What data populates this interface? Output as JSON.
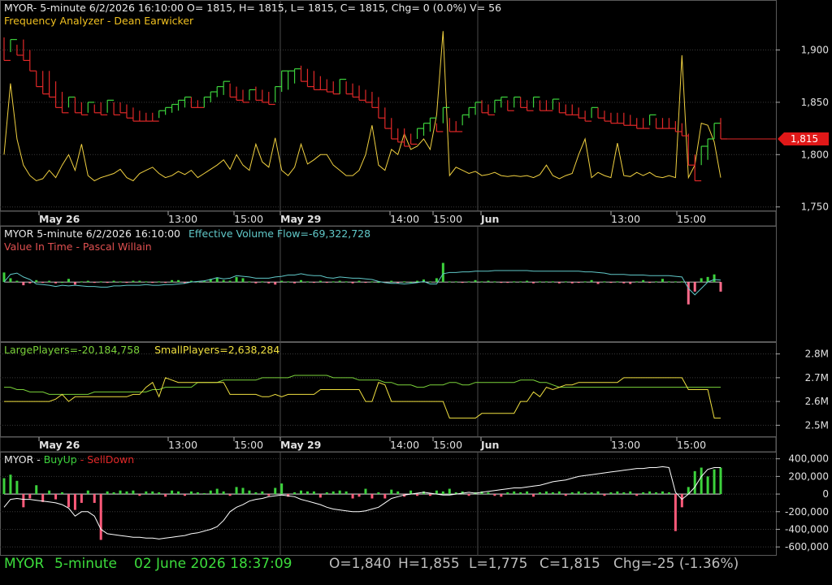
{
  "colors": {
    "background": "#000000",
    "grid": "#3a3a3a",
    "axis_text": "#e0e0e0",
    "up": "#3cd23c",
    "down": "#e02828",
    "yellow": "#f0d040",
    "cyan": "#60c8c8",
    "white": "#ffffff",
    "green_line": "#7ad23a",
    "price_tag": "#e01818",
    "status_green": "#3cdc3c",
    "status_gray": "#bdbdbd"
  },
  "panels": {
    "price": {
      "header_line1": "MYOR- 5-minute 6/2/2026 16:10:00 O= 1815, H= 1815, L= 1815, C= 1815, Chg= 0 (0.0%) V= 56",
      "header_line2": "Frequency Analyzer - Dean Earwicker",
      "last_price_label": "1,815"
    },
    "evf": {
      "header_prefix": "MYOR 5-minute  6/2/2026 16:10:00",
      "header_value": "Effective Volume Flow=-69,322,728",
      "header_line2": "Value In Time - Pascal Willain"
    },
    "players": {
      "large_label": "LargePlayers=-20,184,758",
      "small_label": "SmallPlayers=2,638,284"
    },
    "buysell": {
      "label_symbol": "MYOR - ",
      "label_buy": "BuyUp",
      "label_dash": "-",
      "label_sell": "SellDown"
    }
  },
  "time_axis_labels": [
    "May 26",
    "13:00",
    "15:00",
    "May 29",
    "14:00",
    "15:00",
    "Jun",
    "13:00",
    "15:00"
  ],
  "status_bar": {
    "symbol": "MYOR",
    "interval": "5-minute",
    "datetime": "02 June 2026 18:37:09",
    "open": "O=1,840",
    "high": "H=1,855",
    "low": "L=1,775",
    "close": "C=1,815",
    "change": "Chg=-25 (-1.36%)"
  },
  "chart_data": [
    {
      "type": "line",
      "name": "price",
      "y_ticks": [
        "1,900",
        "1,850",
        "1,800",
        "1,750"
      ],
      "ylim": [
        1742,
        1940
      ],
      "x_points": 112,
      "bar_high": [
        1912,
        1910,
        1905,
        1910,
        1900,
        1880,
        1880,
        1880,
        1870,
        1860,
        1855,
        1855,
        1850,
        1850,
        1848,
        1850,
        1852,
        1850,
        1850,
        1848,
        1845,
        1842,
        1840,
        1840,
        1842,
        1845,
        1848,
        1852,
        1855,
        1855,
        1852,
        1855,
        1860,
        1865,
        1870,
        1868,
        1865,
        1862,
        1862,
        1865,
        1862,
        1860,
        1865,
        1880,
        1880,
        1882,
        1885,
        1882,
        1880,
        1875,
        1872,
        1870,
        1872,
        1870,
        1868,
        1866,
        1862,
        1860,
        1855,
        1845,
        1835,
        1825,
        1825,
        1820,
        1825,
        1830,
        1835,
        1830,
        1845,
        1835,
        1832,
        1838,
        1845,
        1850,
        1852,
        1848,
        1852,
        1855,
        1852,
        1855,
        1855,
        1852,
        1855,
        1852,
        1852,
        1853,
        1850,
        1848,
        1848,
        1845,
        1842,
        1845,
        1845,
        1842,
        1840,
        1840,
        1840,
        1838,
        1835,
        1835,
        1838,
        1835,
        1835,
        1835,
        1832,
        1830,
        1820,
        1800,
        1808,
        1815,
        1830,
        1835
      ],
      "bar_low": [
        1890,
        1898,
        1895,
        1890,
        1880,
        1865,
        1858,
        1855,
        1845,
        1840,
        1845,
        1840,
        1838,
        1840,
        1840,
        1838,
        1840,
        1838,
        1840,
        1835,
        1832,
        1832,
        1832,
        1832,
        1835,
        1838,
        1840,
        1842,
        1845,
        1845,
        1845,
        1845,
        1850,
        1855,
        1857,
        1855,
        1852,
        1850,
        1852,
        1852,
        1850,
        1848,
        1850,
        1860,
        1862,
        1868,
        1870,
        1865,
        1862,
        1862,
        1860,
        1858,
        1858,
        1858,
        1855,
        1852,
        1850,
        1845,
        1835,
        1825,
        1815,
        1812,
        1808,
        1810,
        1815,
        1818,
        1822,
        1822,
        1830,
        1822,
        1822,
        1828,
        1835,
        1838,
        1840,
        1838,
        1840,
        1845,
        1842,
        1845,
        1845,
        1842,
        1845,
        1842,
        1842,
        1843,
        1840,
        1838,
        1838,
        1835,
        1832,
        1835,
        1835,
        1832,
        1830,
        1830,
        1828,
        1828,
        1825,
        1825,
        1828,
        1825,
        1825,
        1825,
        1822,
        1818,
        1790,
        1775,
        1790,
        1795,
        1815,
        1815
      ],
      "bar_up": [
        false,
        true,
        false,
        false,
        false,
        false,
        false,
        false,
        false,
        false,
        true,
        false,
        false,
        true,
        false,
        false,
        true,
        false,
        false,
        false,
        false,
        false,
        false,
        false,
        true,
        true,
        true,
        true,
        true,
        false,
        false,
        true,
        true,
        true,
        true,
        false,
        false,
        false,
        true,
        false,
        false,
        false,
        true,
        true,
        true,
        true,
        false,
        false,
        false,
        false,
        false,
        false,
        true,
        false,
        false,
        false,
        false,
        false,
        false,
        false,
        false,
        false,
        false,
        false,
        true,
        true,
        true,
        false,
        true,
        false,
        false,
        true,
        true,
        true,
        false,
        false,
        true,
        true,
        false,
        true,
        false,
        false,
        true,
        false,
        false,
        true,
        false,
        false,
        false,
        false,
        false,
        true,
        false,
        false,
        false,
        false,
        false,
        false,
        false,
        false,
        true,
        false,
        false,
        false,
        false,
        false,
        false,
        false,
        true,
        true,
        true,
        false
      ],
      "frequency": [
        1800,
        1868,
        1815,
        1790,
        1780,
        1775,
        1777,
        1785,
        1778,
        1790,
        1800,
        1785,
        1810,
        1780,
        1775,
        1778,
        1780,
        1782,
        1786,
        1778,
        1775,
        1782,
        1785,
        1788,
        1782,
        1778,
        1780,
        1784,
        1781,
        1785,
        1778,
        1782,
        1786,
        1790,
        1795,
        1786,
        1800,
        1790,
        1785,
        1810,
        1793,
        1788,
        1816,
        1785,
        1780,
        1788,
        1810,
        1791,
        1795,
        1800,
        1800,
        1790,
        1785,
        1780,
        1780,
        1785,
        1800,
        1828,
        1790,
        1785,
        1805,
        1800,
        1820,
        1805,
        1808,
        1815,
        1805,
        1838,
        1918,
        1780,
        1788,
        1785,
        1782,
        1784,
        1780,
        1781,
        1783,
        1780,
        1779,
        1780,
        1779,
        1780,
        1778,
        1781,
        1790,
        1780,
        1777,
        1780,
        1782,
        1800,
        1815,
        1778,
        1783,
        1780,
        1778,
        1811,
        1780,
        1779,
        1783,
        1780,
        1783,
        1779,
        1778,
        1780,
        1778,
        1895,
        1778,
        1790,
        1830,
        1828,
        1812,
        1778
      ]
    },
    {
      "type": "line",
      "name": "effective-volume-flow",
      "line": [
        0,
        0.12,
        0.14,
        0.08,
        0.04,
        -0.03,
        -0.04,
        -0.05,
        -0.07,
        -0.05,
        -0.06,
        -0.05,
        -0.06,
        -0.07,
        -0.07,
        -0.08,
        -0.08,
        -0.06,
        -0.06,
        -0.05,
        -0.05,
        -0.05,
        -0.04,
        -0.05,
        -0.05,
        -0.04,
        -0.04,
        -0.03,
        -0.02,
        0,
        0.01,
        0.02,
        0.04,
        0.07,
        0.05,
        0.06,
        0.1,
        0.09,
        0.08,
        0.06,
        0.06,
        0.06,
        0.08,
        0.09,
        0.11,
        0.11,
        0.13,
        0.11,
        0.1,
        0.1,
        0.07,
        0.06,
        0.08,
        0.07,
        0.06,
        0.06,
        0.05,
        0.04,
        0.01,
        -0.01,
        -0.02,
        -0.02,
        -0.03,
        -0.02,
        -0.01,
        0.01,
        -0.03,
        -0.03,
        0.13,
        0.15,
        0.15,
        0.16,
        0.16,
        0.17,
        0.17,
        0.17,
        0.18,
        0.18,
        0.18,
        0.18,
        0.18,
        0.18,
        0.17,
        0.17,
        0.17,
        0.17,
        0.17,
        0.17,
        0.17,
        0.17,
        0.16,
        0.16,
        0.15,
        0.14,
        0.12,
        0.12,
        0.12,
        0.11,
        0.11,
        0.11,
        0.1,
        0.1,
        0.1,
        0.1,
        0.09,
        0.08,
        -0.1,
        -0.2,
        -0.1,
        0,
        0.04,
        0.03
      ],
      "bars": [
        0.15,
        0.06,
        0.02,
        -0.05,
        -0.02,
        0.03,
        -0.01,
        0.02,
        -0.02,
        0,
        0.05,
        -0.04,
        0.01,
        0.02,
        -0.01,
        0.01,
        -0.01,
        0.02,
        0.01,
        -0.01,
        0.02,
        0.02,
        0.01,
        -0.01,
        0.01,
        -0.01,
        0.03,
        0.03,
        -0.02,
        0.02,
        0.01,
        0.02,
        0.05,
        0.07,
        0.03,
        0.02,
        0.08,
        0.06,
        0.01,
        -0.02,
        0.01,
        -0.02,
        -0.04,
        0.02,
        0.01,
        -0.02,
        0.03,
        0.01,
        -0.01,
        0.02,
        -0.01,
        0.01,
        0.02,
        0.01,
        -0.02,
        0.02,
        -0.01,
        0.01,
        0,
        -0.01,
        0.02,
        -0.02,
        0.01,
        0,
        0.02,
        0.04,
        0.01,
        0.06,
        0.3,
        0.01,
        0.01,
        -0.01,
        0.01,
        0.03,
        0.01,
        0.02,
        0.01,
        -0.01,
        -0.01,
        0.01,
        0.01,
        0.02,
        -0.02,
        0.01,
        0.01,
        0.01,
        -0.02,
        0.01,
        -0.02,
        -0.01,
        0.01,
        0.03,
        -0.03,
        0.01,
        -0.01,
        0.01,
        -0.02,
        -0.03,
        0.01,
        0.03,
        -0.01,
        0.01,
        0.05,
        0.01,
        0.01,
        0.01,
        -0.35,
        -0.15,
        0.06,
        0.08,
        0.12,
        -0.15
      ],
      "ylim": [
        -0.8,
        0.6
      ]
    },
    {
      "type": "line",
      "name": "large-small-players",
      "y_ticks": [
        "2.8M",
        "2.7M",
        "2.6M",
        "2.5M"
      ],
      "ylim": [
        2.45,
        2.85
      ],
      "large": [
        2.66,
        2.66,
        2.65,
        2.65,
        2.64,
        2.64,
        2.64,
        2.63,
        2.63,
        2.63,
        2.63,
        2.63,
        2.63,
        2.63,
        2.64,
        2.64,
        2.64,
        2.64,
        2.64,
        2.64,
        2.64,
        2.64,
        2.64,
        2.65,
        2.65,
        2.66,
        2.66,
        2.66,
        2.66,
        2.66,
        2.68,
        2.68,
        2.68,
        2.68,
        2.69,
        2.69,
        2.69,
        2.69,
        2.69,
        2.69,
        2.7,
        2.7,
        2.7,
        2.7,
        2.7,
        2.71,
        2.71,
        2.71,
        2.71,
        2.71,
        2.71,
        2.7,
        2.7,
        2.7,
        2.7,
        2.69,
        2.69,
        2.69,
        2.69,
        2.68,
        2.68,
        2.67,
        2.67,
        2.67,
        2.66,
        2.66,
        2.67,
        2.67,
        2.67,
        2.68,
        2.68,
        2.67,
        2.67,
        2.68,
        2.68,
        2.68,
        2.68,
        2.68,
        2.68,
        2.68,
        2.69,
        2.69,
        2.69,
        2.68,
        2.68,
        2.67,
        2.66,
        2.66,
        2.66,
        2.66,
        2.66,
        2.66,
        2.66,
        2.66,
        2.66,
        2.66,
        2.66,
        2.66,
        2.66,
        2.66,
        2.66,
        2.66,
        2.66,
        2.66,
        2.66,
        2.66,
        2.66,
        2.66,
        2.66,
        2.66,
        2.66,
        2.66
      ],
      "small": [
        2.6,
        2.6,
        2.6,
        2.6,
        2.6,
        2.6,
        2.6,
        2.6,
        2.61,
        2.63,
        2.6,
        2.62,
        2.62,
        2.62,
        2.62,
        2.62,
        2.62,
        2.62,
        2.62,
        2.62,
        2.63,
        2.63,
        2.66,
        2.68,
        2.62,
        2.7,
        2.69,
        2.68,
        2.68,
        2.68,
        2.68,
        2.68,
        2.68,
        2.68,
        2.68,
        2.63,
        2.63,
        2.63,
        2.63,
        2.63,
        2.62,
        2.62,
        2.63,
        2.62,
        2.63,
        2.63,
        2.63,
        2.63,
        2.63,
        2.65,
        2.65,
        2.65,
        2.65,
        2.65,
        2.65,
        2.65,
        2.6,
        2.6,
        2.68,
        2.67,
        2.6,
        2.6,
        2.6,
        2.6,
        2.6,
        2.6,
        2.6,
        2.6,
        2.6,
        2.53,
        2.53,
        2.53,
        2.53,
        2.53,
        2.55,
        2.55,
        2.55,
        2.55,
        2.55,
        2.55,
        2.6,
        2.6,
        2.64,
        2.62,
        2.66,
        2.65,
        2.66,
        2.67,
        2.67,
        2.68,
        2.68,
        2.68,
        2.68,
        2.68,
        2.68,
        2.68,
        2.7,
        2.7,
        2.7,
        2.7,
        2.7,
        2.7,
        2.7,
        2.7,
        2.7,
        2.7,
        2.65,
        2.65,
        2.65,
        2.65,
        2.53,
        2.53
      ]
    },
    {
      "type": "bar",
      "name": "buyup-selldown",
      "y_ticks": [
        "400,000",
        "200,000",
        "0",
        "-200,000",
        "-400,000",
        "-600,000"
      ],
      "ylim": [
        -700000,
        480000
      ],
      "bars": [
        180000,
        220000,
        150000,
        -150000,
        -50000,
        100000,
        -90000,
        40000,
        -60000,
        20000,
        -150000,
        -180000,
        -100000,
        40000,
        -100000,
        -520000,
        30000,
        20000,
        40000,
        30000,
        40000,
        -20000,
        30000,
        30000,
        20000,
        -30000,
        40000,
        30000,
        -20000,
        30000,
        20000,
        10000,
        40000,
        60000,
        30000,
        -20000,
        80000,
        70000,
        40000,
        20000,
        30000,
        -20000,
        70000,
        120000,
        -30000,
        20000,
        40000,
        30000,
        30000,
        -40000,
        20000,
        30000,
        40000,
        30000,
        -50000,
        -30000,
        60000,
        -50000,
        20000,
        -50000,
        50000,
        30000,
        -30000,
        40000,
        -20000,
        30000,
        -20000,
        40000,
        30000,
        60000,
        20000,
        30000,
        -20000,
        20000,
        30000,
        20000,
        -20000,
        -30000,
        20000,
        30000,
        20000,
        30000,
        -30000,
        20000,
        30000,
        20000,
        30000,
        -20000,
        20000,
        30000,
        20000,
        20000,
        30000,
        -20000,
        20000,
        30000,
        20000,
        30000,
        -20000,
        20000,
        30000,
        20000,
        30000,
        20000,
        -420000,
        -150000,
        80000,
        260000,
        300000,
        200000,
        280000,
        300000
      ],
      "line": [
        -150000,
        -60000,
        -50000,
        -60000,
        -60000,
        -70000,
        -80000,
        -90000,
        -100000,
        -120000,
        -160000,
        -250000,
        -200000,
        -200000,
        -250000,
        -400000,
        -450000,
        -460000,
        -470000,
        -480000,
        -490000,
        -490000,
        -500000,
        -500000,
        -510000,
        -500000,
        -490000,
        -480000,
        -470000,
        -450000,
        -440000,
        -420000,
        -400000,
        -370000,
        -300000,
        -200000,
        -150000,
        -120000,
        -80000,
        -60000,
        -50000,
        -30000,
        -20000,
        -10000,
        -20000,
        -30000,
        -60000,
        -80000,
        -100000,
        -120000,
        -150000,
        -170000,
        -180000,
        -190000,
        -200000,
        -200000,
        -190000,
        -170000,
        -150000,
        -100000,
        -50000,
        -30000,
        -10000,
        0,
        10000,
        20000,
        10000,
        0,
        -10000,
        -10000,
        0,
        10000,
        20000,
        10000,
        20000,
        30000,
        40000,
        50000,
        60000,
        70000,
        70000,
        80000,
        90000,
        100000,
        120000,
        140000,
        150000,
        160000,
        180000,
        200000,
        210000,
        220000,
        230000,
        240000,
        250000,
        260000,
        270000,
        280000,
        290000,
        290000,
        300000,
        300000,
        310000,
        300000,
        20000,
        -60000,
        0,
        80000,
        200000,
        280000,
        300000,
        300000
      ]
    }
  ]
}
